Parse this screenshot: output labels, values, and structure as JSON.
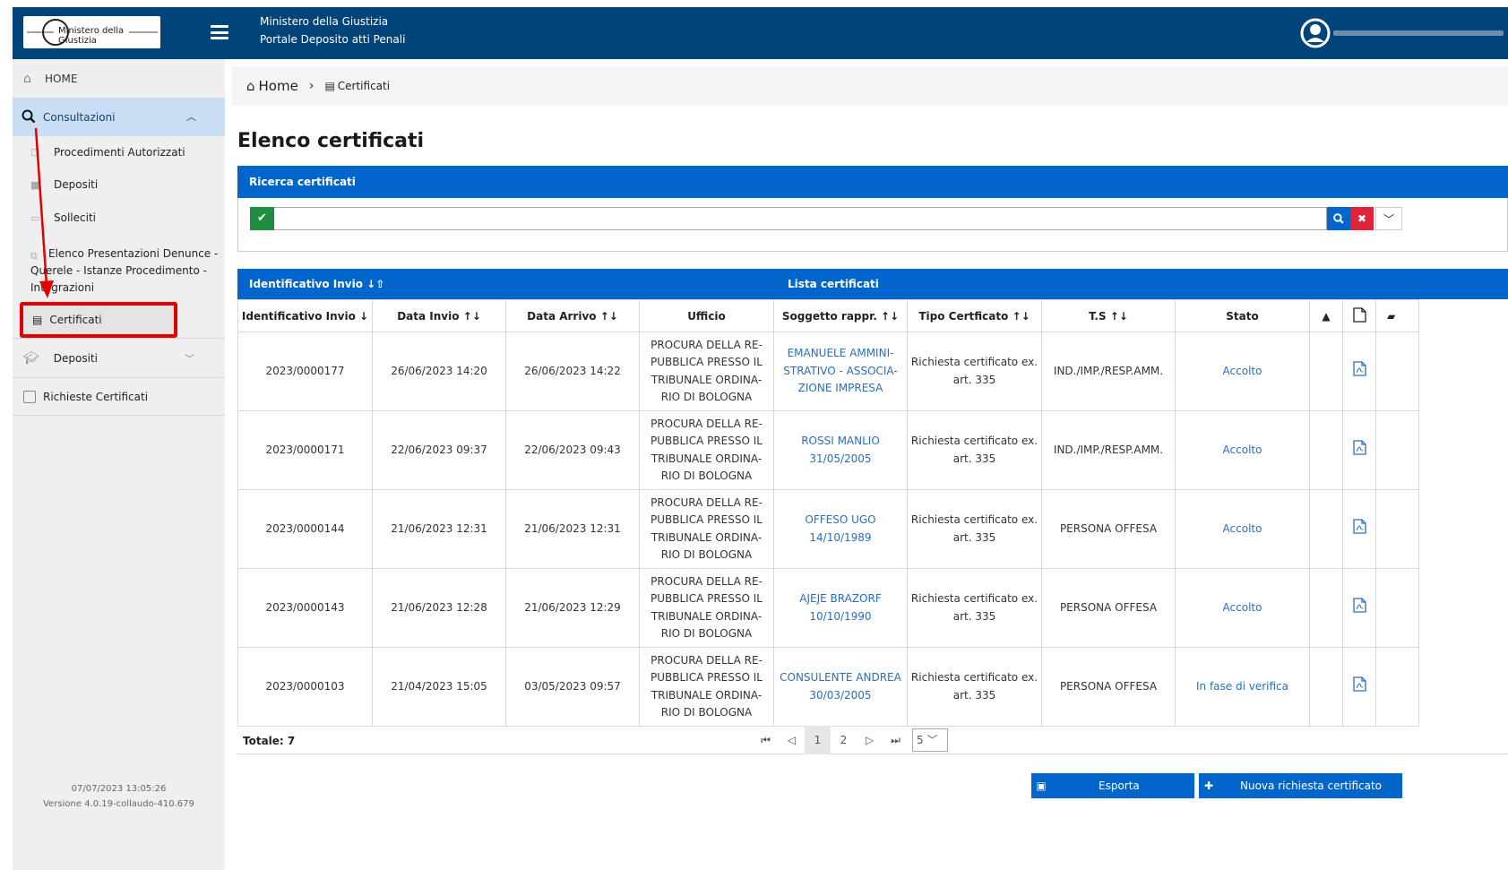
{
  "header": {
    "logo_text": "Ministero della Giustizia",
    "title_line1": "Ministero della Giustizia",
    "title_line2": "Portale Deposito atti Penali"
  },
  "sidebar": {
    "home": "HOME",
    "consultazioni": "Consultazioni",
    "sub_items": [
      "Procedimenti Autorizzati",
      "Depositi",
      "Solleciti",
      "Elenco Presentazioni Denunce -",
      "Querele - Istanze Procedimento -",
      "Integrazioni"
    ],
    "certificati": "Certificati",
    "depositi": "Depositi",
    "richieste_certificati": "Richieste Certificati",
    "footer_date": "07/07/2023 13:05:26",
    "footer_version": "Versione 4.0.19-collaudo-410.679"
  },
  "breadcrumb": {
    "home": "Home",
    "current": "Certificati"
  },
  "page_title": "Elenco certificati",
  "search": {
    "header": "Ricerca certificati",
    "value": ""
  },
  "list": {
    "header_left": "Identificativo Invio ↓⇧",
    "header_center": "Lista certificati",
    "columns": [
      "Identificativo Invio ↓",
      "Data Invio ↑↓",
      "Data Arrivo ↑↓",
      "Ufficio",
      "Soggetto rappr. ↑↓",
      "Tipo Certficato ↑↓",
      "T.S ↑↓",
      "Stato"
    ],
    "rows": [
      {
        "id": "2023/0000177",
        "data_invio": "26/06/2023 14:20",
        "data_arrivo": "26/06/2023 14:22",
        "ufficio": [
          "PROCURA DELLA RE-",
          "PUBBLICA PRESSO IL",
          "TRIBUNALE ORDINA-",
          "RIO DI BOLOGNA"
        ],
        "soggetto": [
          "EMANUELE AMMINI-",
          "STRATIVO - ASSOCIA-",
          "ZIONE IMPRESA"
        ],
        "tipo": [
          "Richiesta certificato ex.",
          "art. 335"
        ],
        "ts": "IND./IMP./RESP.AMM.",
        "stato": "Accolto"
      },
      {
        "id": "2023/0000171",
        "data_invio": "22/06/2023 09:37",
        "data_arrivo": "22/06/2023 09:43",
        "ufficio": [
          "PROCURA DELLA RE-",
          "PUBBLICA PRESSO IL",
          "TRIBUNALE ORDINA-",
          "RIO DI BOLOGNA"
        ],
        "soggetto": [
          "ROSSI MANLIO",
          "31/05/2005"
        ],
        "tipo": [
          "Richiesta certificato ex.",
          "art. 335"
        ],
        "ts": "IND./IMP./RESP.AMM.",
        "stato": "Accolto"
      },
      {
        "id": "2023/0000144",
        "data_invio": "21/06/2023 12:31",
        "data_arrivo": "21/06/2023 12:31",
        "ufficio": [
          "PROCURA DELLA RE-",
          "PUBBLICA PRESSO IL",
          "TRIBUNALE ORDINA-",
          "RIO DI BOLOGNA"
        ],
        "soggetto": [
          "OFFESO UGO",
          "14/10/1989"
        ],
        "tipo": [
          "Richiesta certificato ex.",
          "art. 335"
        ],
        "ts": "PERSONA OFFESA",
        "stato": "Accolto"
      },
      {
        "id": "2023/0000143",
        "data_invio": "21/06/2023 12:28",
        "data_arrivo": "21/06/2023 12:29",
        "ufficio": [
          "PROCURA DELLA RE-",
          "PUBBLICA PRESSO IL",
          "TRIBUNALE ORDINA-",
          "RIO DI BOLOGNA"
        ],
        "soggetto": [
          "AJEJE BRAZORF",
          "10/10/1990"
        ],
        "tipo": [
          "Richiesta certificato ex.",
          "art. 335"
        ],
        "ts": "PERSONA OFFESA",
        "stato": "Accolto"
      },
      {
        "id": "2023/0000103",
        "data_invio": "21/04/2023 15:05",
        "data_arrivo": "03/05/2023 09:57",
        "ufficio": [
          "PROCURA DELLA RE-",
          "PUBBLICA PRESSO IL",
          "TRIBUNALE ORDINA-",
          "RIO DI BOLOGNA"
        ],
        "soggetto": [
          "CONSULENTE ANDREA",
          "30/03/2005"
        ],
        "tipo": [
          "Richiesta certificato ex.",
          "art. 335"
        ],
        "ts": "PERSONA OFFESA",
        "stato": "In fase di verifica"
      }
    ],
    "totale": "Totale: 7",
    "pages": [
      "1",
      "2"
    ],
    "page_size": "5"
  },
  "buttons": {
    "esporta": "Esporta",
    "nuova": "Nuova richiesta certificato"
  },
  "colors": {
    "header_bg": "#00447a",
    "primary": "#0066cc",
    "highlight_box": "#e00000",
    "link": "#2a6ebb"
  },
  "icons": [
    "menu-icon",
    "user-icon",
    "home-icon",
    "search-icon",
    "chevron-up-icon",
    "chevron-down-icon",
    "file-icon",
    "graduation-cap-icon",
    "check-icon",
    "close-icon",
    "warning-icon",
    "pdf-icon",
    "folder-open-icon",
    "excel-icon",
    "plus-icon"
  ]
}
